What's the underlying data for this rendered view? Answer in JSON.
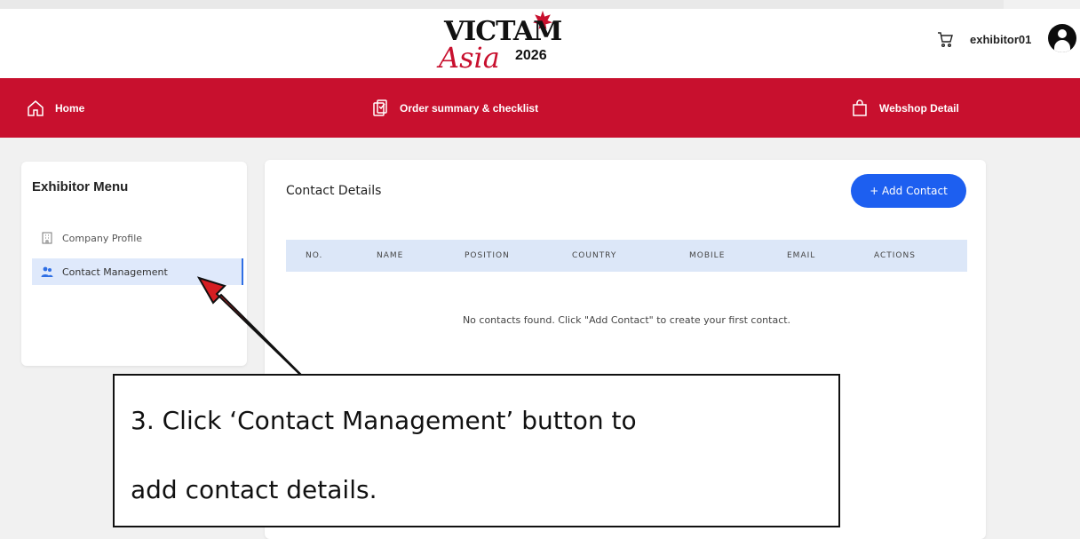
{
  "header": {
    "logo": {
      "word_top": "VICTAM",
      "word_script": "Asia",
      "year": "2026"
    },
    "username": "exhibitor01"
  },
  "nav": {
    "items": [
      {
        "label": "Home",
        "icon": "home-icon"
      },
      {
        "label": "Order summary & checklist",
        "icon": "clipboard-icon"
      },
      {
        "label": "Webshop Detail",
        "icon": "shopping-bag-icon"
      }
    ]
  },
  "sidebar": {
    "title": "Exhibitor Menu",
    "items": [
      {
        "label": "Company Profile",
        "icon": "building-icon",
        "active": false
      },
      {
        "label": "Contact Management",
        "icon": "users-icon",
        "active": true
      }
    ]
  },
  "main": {
    "title": "Contact Details",
    "add_button": "+ Add Contact",
    "columns": [
      "NO.",
      "NAME",
      "POSITION",
      "COUNTRY",
      "MOBILE",
      "EMAIL",
      "ACTIONS"
    ],
    "empty_message": "No contacts found. Click \"Add Contact\" to create your first contact."
  },
  "annotation": {
    "line1": "3. Click ‘Contact Management’ button to",
    "line2": "add contact details."
  },
  "colors": {
    "brand_red": "#c8102e",
    "accent_blue": "#1d5ff0",
    "table_header": "#dce7f8"
  }
}
